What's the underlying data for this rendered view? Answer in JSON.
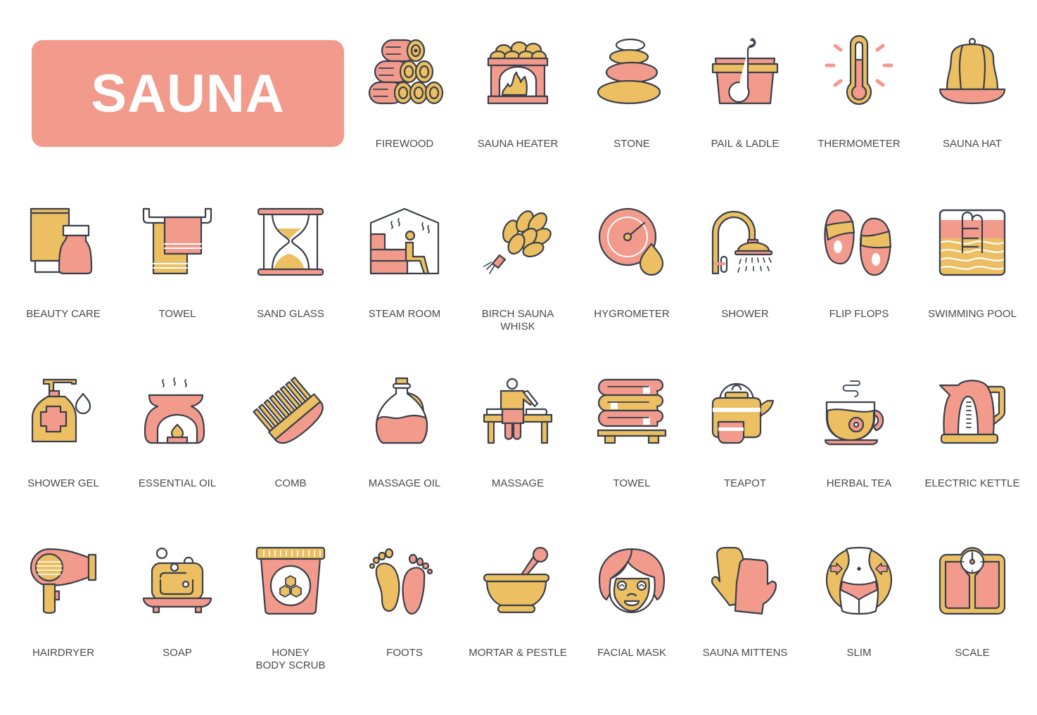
{
  "banner": {
    "title": "SAUNA"
  },
  "colors": {
    "pink": "#f29a8c",
    "gold": "#ebbf62",
    "outline": "#3a3f4a",
    "label": "#4a4a4a",
    "background": "#ffffff"
  },
  "icons": [
    {
      "label": "FIREWOOD",
      "icon": "firewood-icon"
    },
    {
      "label": "SAUNA HEATER",
      "icon": "sauna-heater-icon"
    },
    {
      "label": "STONE",
      "icon": "stone-icon"
    },
    {
      "label": "PAIL & LADLE",
      "icon": "pail-ladle-icon"
    },
    {
      "label": "THERMOMETER",
      "icon": "thermometer-icon"
    },
    {
      "label": "SAUNA HAT",
      "icon": "sauna-hat-icon"
    },
    {
      "label": "BEAUTY CARE",
      "icon": "beauty-care-icon"
    },
    {
      "label": "TOWEL",
      "icon": "towel-rack-icon"
    },
    {
      "label": "SAND GLASS",
      "icon": "sand-glass-icon"
    },
    {
      "label": "STEAM ROOM",
      "icon": "steam-room-icon"
    },
    {
      "label": "BIRCH SAUNA\nWHISK",
      "icon": "birch-whisk-icon"
    },
    {
      "label": "HYGROMETER",
      "icon": "hygrometer-icon"
    },
    {
      "label": "SHOWER",
      "icon": "shower-icon"
    },
    {
      "label": "FLIP FLOPS",
      "icon": "flip-flops-icon"
    },
    {
      "label": "SWIMMING POOL",
      "icon": "swimming-pool-icon"
    },
    {
      "label": "SHOWER GEL",
      "icon": "shower-gel-icon"
    },
    {
      "label": "ESSENTIAL OIL",
      "icon": "essential-oil-icon"
    },
    {
      "label": "COMB",
      "icon": "comb-icon"
    },
    {
      "label": "MASSAGE OIL",
      "icon": "massage-oil-icon"
    },
    {
      "label": "MASSAGE",
      "icon": "massage-icon"
    },
    {
      "label": "TOWEL",
      "icon": "towel-stack-icon"
    },
    {
      "label": "TEAPOT",
      "icon": "teapot-icon"
    },
    {
      "label": "HERBAL TEA",
      "icon": "herbal-tea-icon"
    },
    {
      "label": "ELECTRIC KETTLE",
      "icon": "electric-kettle-icon"
    },
    {
      "label": "HAIRDRYER",
      "icon": "hairdryer-icon"
    },
    {
      "label": "SOAP",
      "icon": "soap-icon"
    },
    {
      "label": "HONEY\nBODY SCRUB",
      "icon": "honey-body-scrub-icon"
    },
    {
      "label": "FOOTS",
      "icon": "footprints-icon"
    },
    {
      "label": "MORTAR & PESTLE",
      "icon": "mortar-pestle-icon"
    },
    {
      "label": "FACIAL MASK",
      "icon": "facial-mask-icon"
    },
    {
      "label": "SAUNA MITTENS",
      "icon": "sauna-mittens-icon"
    },
    {
      "label": "SLIM",
      "icon": "slim-icon"
    },
    {
      "label": "SCALE",
      "icon": "scale-icon"
    }
  ]
}
